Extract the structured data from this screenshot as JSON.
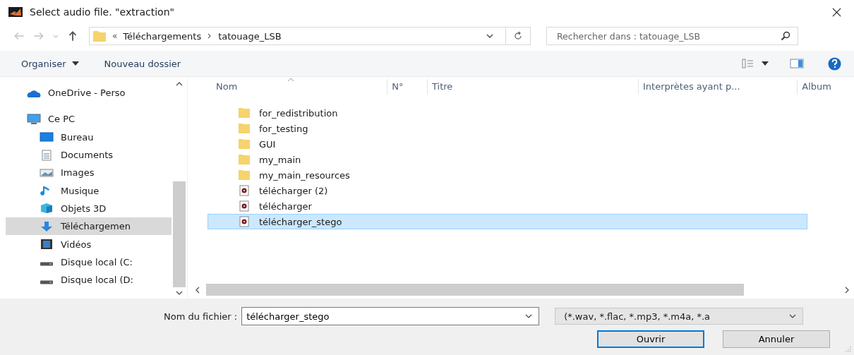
{
  "window": {
    "title": "Select audio file. \"extraction\""
  },
  "address": {
    "overflow": "«",
    "path": [
      "Téléchargements",
      "tatouage_LSB"
    ]
  },
  "search": {
    "placeholder": "Rechercher dans : tatouage_LSB"
  },
  "toolbar": {
    "organize": "Organiser",
    "new_folder": "Nouveau dossier"
  },
  "sidebar": {
    "items": [
      {
        "label": "OneDrive - Perso",
        "kind": "cloud",
        "selected": false
      },
      {
        "label": "Ce PC",
        "kind": "pc",
        "selected": false,
        "children": [
          {
            "label": "Bureau",
            "kind": "desktop",
            "selected": false
          },
          {
            "label": "Documents",
            "kind": "documents",
            "selected": false
          },
          {
            "label": "Images",
            "kind": "images",
            "selected": false
          },
          {
            "label": "Musique",
            "kind": "music",
            "selected": false
          },
          {
            "label": "Objets 3D",
            "kind": "cube",
            "selected": false
          },
          {
            "label": "Téléchargemen",
            "kind": "download",
            "selected": true
          },
          {
            "label": "Vidéos",
            "kind": "video",
            "selected": false
          },
          {
            "label": "Disque local (C:",
            "kind": "drive",
            "selected": false
          },
          {
            "label": "Disque local (D:",
            "kind": "drive",
            "selected": false
          }
        ]
      }
    ]
  },
  "table": {
    "columns": [
      "Nom",
      "N°",
      "Titre",
      "Interprètes ayant p...",
      "Album"
    ],
    "rows": [
      {
        "name": "for_redistribution",
        "kind": "folder",
        "selected": false
      },
      {
        "name": "for_testing",
        "kind": "folder",
        "selected": false
      },
      {
        "name": "GUI",
        "kind": "folder",
        "selected": false
      },
      {
        "name": "my_main",
        "kind": "folder",
        "selected": false
      },
      {
        "name": "my_main_resources",
        "kind": "folder",
        "selected": false
      },
      {
        "name": "télécharger (2)",
        "kind": "audio",
        "selected": false
      },
      {
        "name": "télécharger",
        "kind": "audio",
        "selected": false
      },
      {
        "name": "télécharger_stego",
        "kind": "audio",
        "selected": true
      }
    ]
  },
  "footer": {
    "filename_label": "Nom du fichier :",
    "filename": "télécharger_stego",
    "filter": "(*.wav, *.flac, *.mp3, *.m4a, *.a",
    "buttons": [
      "Ouvrir",
      "Annuler"
    ]
  }
}
